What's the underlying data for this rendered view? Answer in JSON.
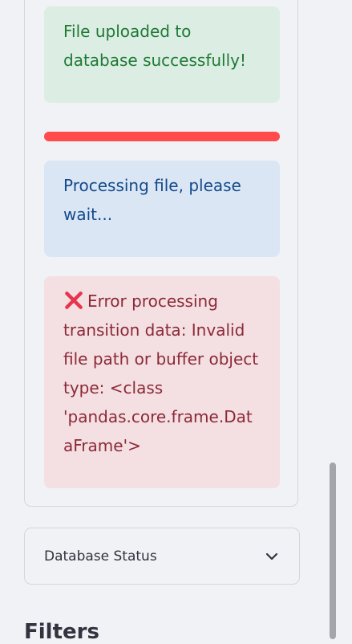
{
  "alerts": {
    "success": "File uploaded to database successfully!",
    "info": "Processing file, please wait...",
    "error": "Error processing transition data: Invalid file path or buffer object type: <class 'pandas.core.frame.DataFrame'>"
  },
  "progress": {
    "value_percent": 100,
    "color": "#ff4b4b"
  },
  "expander": {
    "label": "Database Status",
    "icon": "chevron-down-icon"
  },
  "sidebar": {
    "section_title": "Filters"
  },
  "icons": {
    "error": "x-icon"
  },
  "colors": {
    "success_bg": "#dcede4",
    "success_text": "#1e7a33",
    "info_bg": "#dbe6f4",
    "info_text": "#124a8c",
    "error_bg": "#f4dfe2",
    "error_text": "#8b2a37",
    "error_icon": "#e8344c"
  }
}
